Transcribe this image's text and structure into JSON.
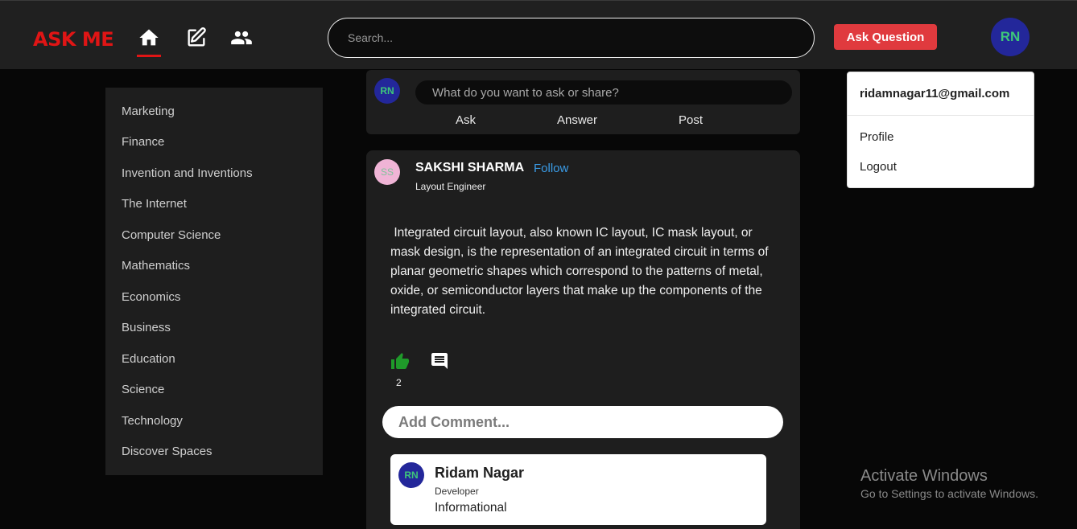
{
  "header": {
    "logo": "ASK ME",
    "search_placeholder": "Search...",
    "ask_button": "Ask Question",
    "avatar_initials": "RN",
    "nav_icons": [
      "home-icon",
      "edit-icon",
      "people-icon"
    ]
  },
  "sidebar": {
    "items": [
      {
        "label": "Marketing"
      },
      {
        "label": "Finance"
      },
      {
        "label": "Invention and Inventions"
      },
      {
        "label": "The Internet"
      },
      {
        "label": "Computer Science"
      },
      {
        "label": "Mathematics"
      },
      {
        "label": "Economics"
      },
      {
        "label": "Business"
      },
      {
        "label": "Education"
      },
      {
        "label": "Science"
      },
      {
        "label": "Technology"
      },
      {
        "label": "Discover Spaces"
      }
    ]
  },
  "composer": {
    "avatar_initials": "RN",
    "placeholder": "What do you want to ask or share?",
    "actions": [
      "Ask",
      "Answer",
      "Post"
    ]
  },
  "post": {
    "avatar_initials": "SS",
    "author": "SAKSHI SHARMA",
    "follow_label": "Follow",
    "role": "Layout Engineer",
    "text": " Integrated circuit layout, also known IC layout, IC mask layout, or mask design, is the representation of an integrated circuit in terms of planar geometric shapes which correspond to the patterns of metal, oxide, or semiconductor layers that make up the components of the integrated circuit.",
    "like_count": "2",
    "comment_placeholder": "Add Comment...",
    "comment": {
      "avatar_initials": "RN",
      "name": "Ridam Nagar",
      "role": "Developer",
      "text": "Informational"
    }
  },
  "dropdown": {
    "email": "ridamnagar11@gmail.com",
    "items": [
      "Profile",
      "Logout"
    ]
  },
  "watermark": {
    "title": "Activate Windows",
    "subtitle": "Go to Settings to activate Windows."
  },
  "colors": {
    "brand": "#e01515",
    "accent_button": "#e03a3e",
    "follow": "#3a9be6",
    "like": "#1f9a2a",
    "avatar_bg": "#23279a",
    "avatar_text": "#3ec77a"
  }
}
